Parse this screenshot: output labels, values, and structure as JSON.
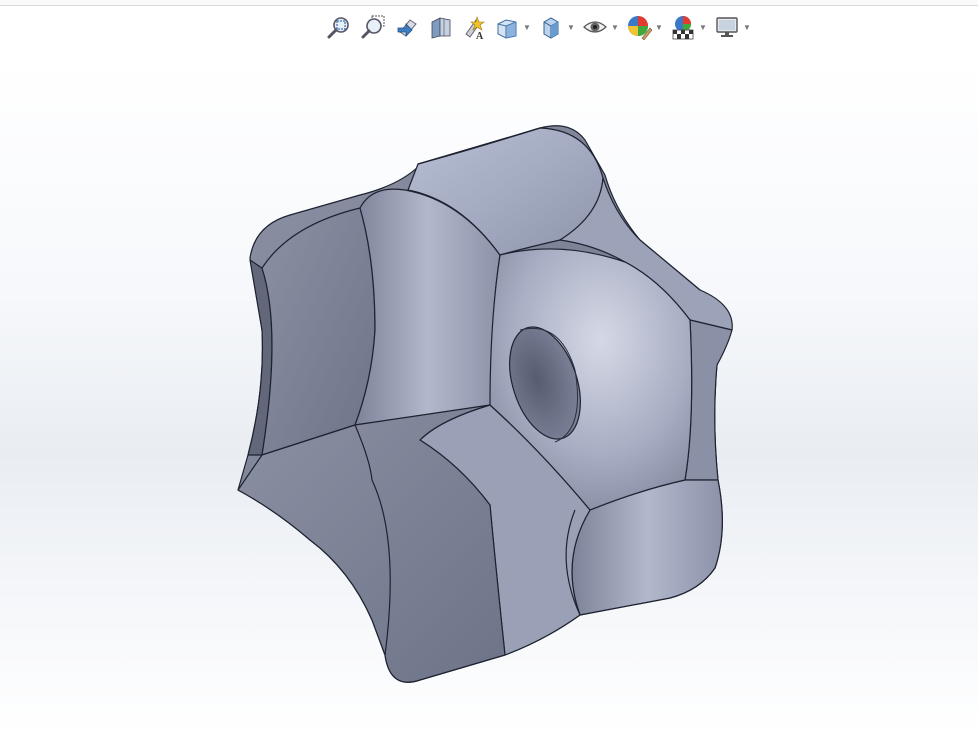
{
  "toolbar": {
    "items": [
      {
        "name": "zoom-to-fit",
        "icon": "zoom-to-fit-icon"
      },
      {
        "name": "zoom-to-area",
        "icon": "zoom-to-area-icon"
      },
      {
        "name": "previous-view",
        "icon": "previous-view-icon"
      },
      {
        "name": "section-view",
        "icon": "section-view-icon"
      },
      {
        "name": "dynamic-annotation-views",
        "icon": "dynamic-annotation-icon"
      },
      {
        "name": "view-orientation",
        "icon": "view-orientation-icon",
        "dropdown": true
      },
      {
        "name": "display-style",
        "icon": "display-style-icon",
        "dropdown": true
      },
      {
        "name": "hide-show-items",
        "icon": "eye-icon",
        "dropdown": true
      },
      {
        "name": "edit-appearance",
        "icon": "appearance-icon",
        "dropdown": true
      },
      {
        "name": "apply-scene",
        "icon": "scene-icon",
        "dropdown": true
      },
      {
        "name": "view-settings",
        "icon": "monitor-icon",
        "dropdown": true
      }
    ]
  },
  "model": {
    "type": "hexagonal star knob",
    "color": "#9aa1b8"
  }
}
